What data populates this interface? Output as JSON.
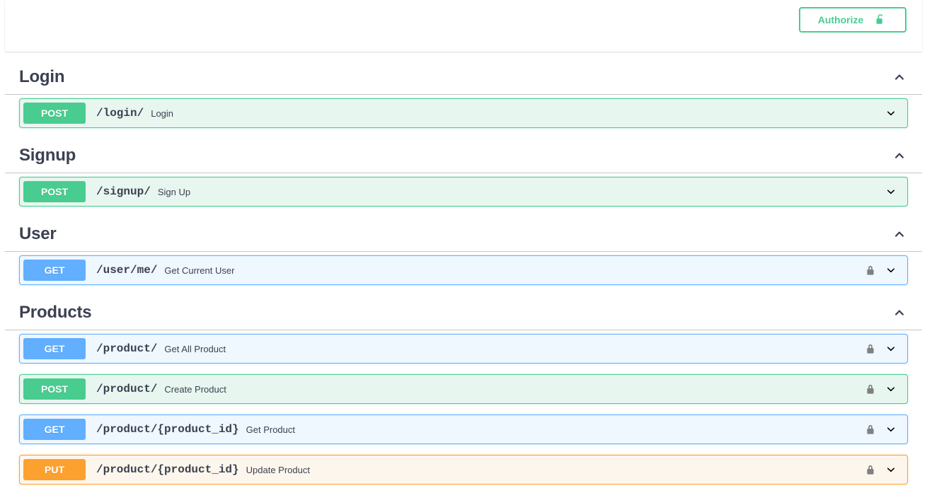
{
  "topbar": {
    "authorize_label": "Authorize",
    "authorize_icon": "unlock-icon"
  },
  "colors": {
    "get": "#61affe",
    "post": "#49cc90",
    "put": "#fca130",
    "delete": "#f93e3e",
    "authorize_green": "#49cc90",
    "text": "#3b4151",
    "lock_gray": "#808080"
  },
  "sections": [
    {
      "tag": "Login",
      "collapse_icon": "chevron-up-icon",
      "operations": [
        {
          "method": "POST",
          "method_class": "post",
          "path": "/login/",
          "summary": "Login",
          "locked": false,
          "arrow_icon": "chevron-down-icon"
        }
      ]
    },
    {
      "tag": "Signup",
      "collapse_icon": "chevron-up-icon",
      "operations": [
        {
          "method": "POST",
          "method_class": "post",
          "path": "/signup/",
          "summary": "Sign Up",
          "locked": false,
          "arrow_icon": "chevron-down-icon"
        }
      ]
    },
    {
      "tag": "User",
      "collapse_icon": "chevron-up-icon",
      "operations": [
        {
          "method": "GET",
          "method_class": "get",
          "path": "/user/me/",
          "summary": "Get Current User",
          "locked": true,
          "lock_icon": "lock-icon",
          "arrow_icon": "chevron-down-icon"
        }
      ]
    },
    {
      "tag": "Products",
      "collapse_icon": "chevron-up-icon",
      "operations": [
        {
          "method": "GET",
          "method_class": "get",
          "path": "/product/",
          "summary": "Get All Product",
          "locked": true,
          "lock_icon": "lock-icon",
          "arrow_icon": "chevron-down-icon"
        },
        {
          "method": "POST",
          "method_class": "post",
          "path": "/product/",
          "summary": "Create Product",
          "locked": true,
          "lock_icon": "lock-icon",
          "arrow_icon": "chevron-down-icon"
        },
        {
          "method": "GET",
          "method_class": "get",
          "path": "/product/{product_id}",
          "summary": "Get Product",
          "locked": true,
          "lock_icon": "lock-icon",
          "arrow_icon": "chevron-down-icon"
        },
        {
          "method": "PUT",
          "method_class": "put",
          "path": "/product/{product_id}",
          "summary": "Update Product",
          "locked": true,
          "lock_icon": "lock-icon",
          "arrow_icon": "chevron-down-icon"
        }
      ]
    }
  ]
}
